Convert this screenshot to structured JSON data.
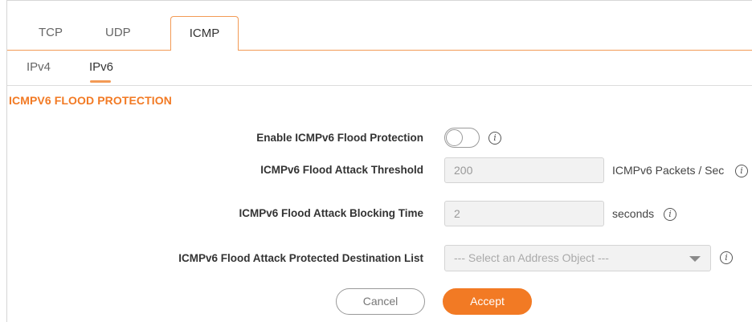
{
  "tabs": [
    {
      "label": "TCP"
    },
    {
      "label": "UDP"
    },
    {
      "label": "ICMP"
    }
  ],
  "active_tab": "ICMP",
  "subtabs": [
    {
      "label": "IPv4"
    },
    {
      "label": "IPv6"
    }
  ],
  "active_subtab": "IPv6",
  "section_title": "ICMPV6 FLOOD PROTECTION",
  "form": {
    "enable": {
      "label": "Enable ICMPv6 Flood Protection",
      "value": "off"
    },
    "threshold": {
      "label": "ICMPv6 Flood Attack Threshold",
      "value": "200",
      "unit": "ICMPv6 Packets / Sec"
    },
    "blocking_time": {
      "label": "ICMPv6 Flood Attack Blocking Time",
      "value": "2",
      "unit": "seconds"
    },
    "destination_list": {
      "label": "ICMPv6 Flood Attack Protected Destination List",
      "value": "--- Select an Address Object ---"
    }
  },
  "info_glyph": "i",
  "buttons": {
    "cancel": "Cancel",
    "accept": "Accept"
  },
  "colors": {
    "accent": "#f27a24",
    "tab_border": "#f39a55"
  },
  "icons": [
    "info-icon",
    "chevron-down-icon"
  ]
}
